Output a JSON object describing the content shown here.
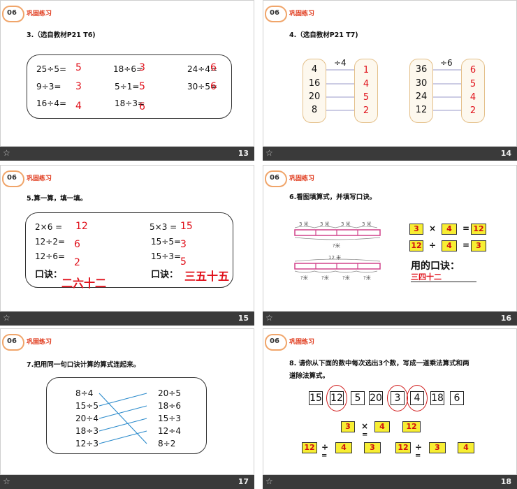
{
  "common": {
    "section_label": "巩固练习",
    "badge": "06",
    "star": "☆"
  },
  "slides": {
    "s13": {
      "page": "13",
      "title": "3.（选自教材P21 T6)",
      "rows": [
        [
          "25÷5=",
          "18÷6=",
          "24÷4="
        ],
        [
          "9÷3=",
          "5÷1=",
          "30÷5="
        ],
        [
          "16÷4=",
          "18÷3=",
          ""
        ]
      ],
      "answers": [
        [
          "5",
          "3",
          "6"
        ],
        [
          "3",
          "5",
          "6"
        ],
        [
          "4",
          "6",
          ""
        ]
      ]
    },
    "s14": {
      "page": "14",
      "title": "4.（选自教材P21 T7)",
      "left_op": "÷4",
      "left_in": [
        "4",
        "16",
        "20",
        "8"
      ],
      "left_out": [
        "1",
        "4",
        "5",
        "2"
      ],
      "right_op": "÷6",
      "right_in": [
        "36",
        "30",
        "24",
        "12"
      ],
      "right_out": [
        "6",
        "5",
        "4",
        "2"
      ]
    },
    "s15": {
      "page": "15",
      "title": "5.算一算，填一填。",
      "left_eq": [
        "2×6 =",
        "12÷2=",
        "12÷6="
      ],
      "left_ans": [
        "12",
        "6",
        "2"
      ],
      "right_eq": [
        "5×3 =",
        "15÷5=",
        "15÷3="
      ],
      "right_ans": [
        "15",
        "3",
        "5"
      ],
      "koujue_label": "口诀：",
      "left_koujue": "二六十二",
      "right_koujue": "三五十五"
    },
    "s16": {
      "page": "16",
      "title": "6.看图填算式，并填写口诀。",
      "bar1_labels": [
        "3 米",
        "3 米",
        "3 米",
        "3 米"
      ],
      "bar1_total": "?米",
      "bar2_total": "12 米",
      "bar2_labels": [
        "?米",
        "?米",
        "?米",
        "?米"
      ],
      "eq1": [
        "3",
        "×",
        "4",
        "=",
        "12"
      ],
      "eq2": [
        "12",
        "÷",
        "4",
        "=",
        "3"
      ],
      "used_label": "用的口诀：",
      "used_answer": "三四十二"
    },
    "s17": {
      "page": "17",
      "title": "7.把用同一句口诀计算的算式连起来。",
      "left": [
        "8÷4",
        "15÷5",
        "20÷4",
        "18÷3",
        "12÷3"
      ],
      "right": [
        "20÷5",
        "18÷6",
        "15÷3",
        "12÷4",
        "8÷2"
      ]
    },
    "s18": {
      "page": "18",
      "title_line1": "8. 请你从下面的数中每次选出3个数，写成一道乘法算式和两",
      "title_line2": "道除法算式。",
      "numbers": [
        "15",
        "12",
        "5",
        "20",
        "3",
        "4",
        "18",
        "6"
      ],
      "mult": [
        "3",
        "×",
        "4",
        "12"
      ],
      "div1": [
        "12",
        "÷",
        "4",
        "3"
      ],
      "div2": [
        "12",
        "÷",
        "3",
        "4"
      ],
      "eq_sign": "="
    }
  }
}
